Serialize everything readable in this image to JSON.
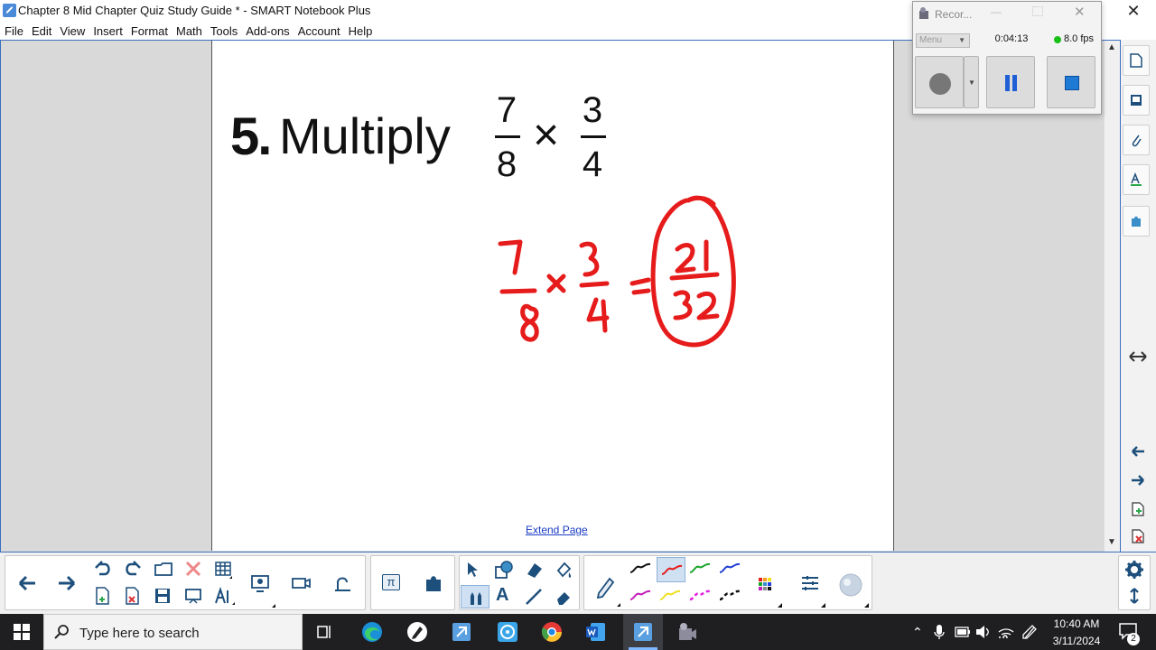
{
  "window": {
    "title": "Chapter 8 Mid Chapter Quiz Study Guide * - SMART Notebook Plus",
    "close": "✕"
  },
  "menu": [
    "File",
    "Edit",
    "View",
    "Insert",
    "Format",
    "Math",
    "Tools",
    "Add-ons",
    "Account",
    "Help"
  ],
  "page": {
    "question_number": "5.",
    "question_text": "Multiply",
    "fraction1": {
      "num": "7",
      "den": "8"
    },
    "operator": "×",
    "fraction2": {
      "num": "3",
      "den": "4"
    },
    "extend_link": "Extend Page"
  },
  "handwriting": {
    "f1_num": "7",
    "f1_den": "8",
    "times": "x",
    "f2_num": "3",
    "f2_den": "4",
    "equals": "=",
    "result_num": "21",
    "result_den": "32",
    "color": "#e61b1b"
  },
  "recorder": {
    "title": "Recor...",
    "menu_label": "Menu",
    "time": "0:04:13",
    "fps": "8.0 fps"
  },
  "taskbar": {
    "search_placeholder": "Type here to search",
    "time": "10:40 AM",
    "date": "3/11/2024",
    "notification_count": "2"
  },
  "colors": {
    "accent": "#3c6fbf",
    "ink_red": "#e61b1b",
    "link": "#1a3cc4"
  }
}
